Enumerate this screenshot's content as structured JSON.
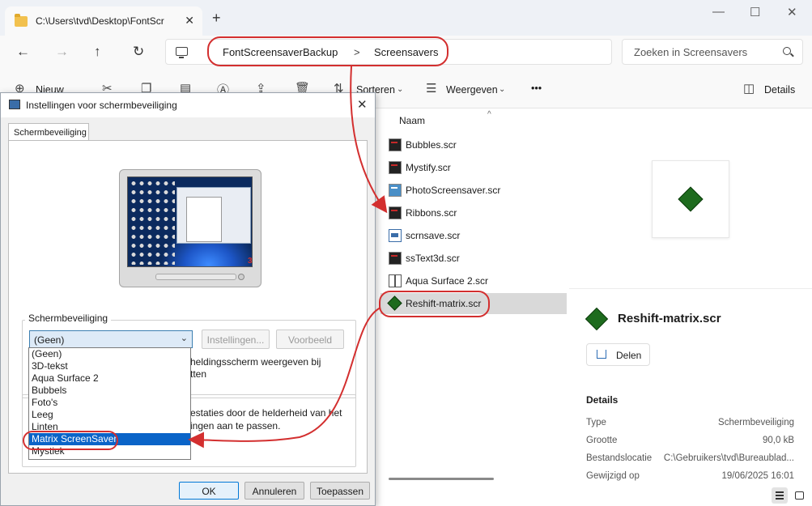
{
  "explorer": {
    "tab_title": "C:\\Users\\tvd\\Desktop\\FontScr",
    "tab_close": "✕",
    "new_tab": "+",
    "window_controls": {
      "minimize": "—",
      "maximize": "☐",
      "close": "✕"
    },
    "nav": {
      "back": "←",
      "forward": "→",
      "up": "↑",
      "refresh": "↻"
    },
    "breadcrumb": [
      "FontScreensaverBackup",
      "Screensavers"
    ],
    "breadcrumb_sep": ">",
    "search_placeholder": "Zoeken in Screensavers",
    "toolbar": {
      "new": "Nieuw",
      "sort": "Sorteren",
      "view": "Weergeven",
      "more": "•••",
      "details": "Details"
    },
    "column_name": "Naam",
    "files": [
      {
        "name": "Bubbles.scr",
        "icon": "screensaver-icon"
      },
      {
        "name": "Mystify.scr",
        "icon": "screensaver-icon"
      },
      {
        "name": "PhotoScreensaver.scr",
        "icon": "photo-screensaver-icon"
      },
      {
        "name": "Ribbons.scr",
        "icon": "screensaver-icon"
      },
      {
        "name": "scrnsave.scr",
        "icon": "scrnsave-icon"
      },
      {
        "name": "ssText3d.scr",
        "icon": "screensaver-icon"
      },
      {
        "name": "Aqua Surface 2.scr",
        "icon": "package-icon"
      },
      {
        "name": "Reshift-matrix.scr",
        "icon": "matrix-icon",
        "selected": true
      }
    ],
    "details_pane": {
      "file_title": "Reshift-matrix.scr",
      "share_label": "Delen",
      "section": "Details",
      "rows": [
        {
          "key": "Type",
          "value": "Schermbeveiliging"
        },
        {
          "key": "Grootte",
          "value": "90,0 kB"
        },
        {
          "key": "Bestandslocatie",
          "value": "C:\\Gebruikers\\tvd\\Bureaublad..."
        },
        {
          "key": "Gewijzigd op",
          "value": "19/06/2025 16:01"
        }
      ]
    }
  },
  "dialog": {
    "title": "Instellingen voor schermbeveiliging",
    "close": "✕",
    "tab": "Schermbeveiliging",
    "preview_badge": "3",
    "group_label": "Schermbeveiliging",
    "combo_value": "(Geen)",
    "combo_arrow": "⌄",
    "settings_button": "Instellingen...",
    "preview_button": "Voorbeeld",
    "resume_line1": "heldingsscherm weergeven bij",
    "resume_line2": "tten",
    "power_line1": "estaties door de helderheid van het",
    "power_line2": "ingen aan te passen.",
    "options": [
      "(Geen)",
      "3D-tekst",
      "Aqua Surface 2",
      "Bubbels",
      "Foto's",
      "Leeg",
      "Linten",
      "Matrix ScreenSaver",
      "Mystiek"
    ],
    "selected_option": "Matrix ScreenSaver",
    "buttons": {
      "ok": "OK",
      "cancel": "Annuleren",
      "apply": "Toepassen"
    }
  },
  "annotation_color": "#d32f2f"
}
